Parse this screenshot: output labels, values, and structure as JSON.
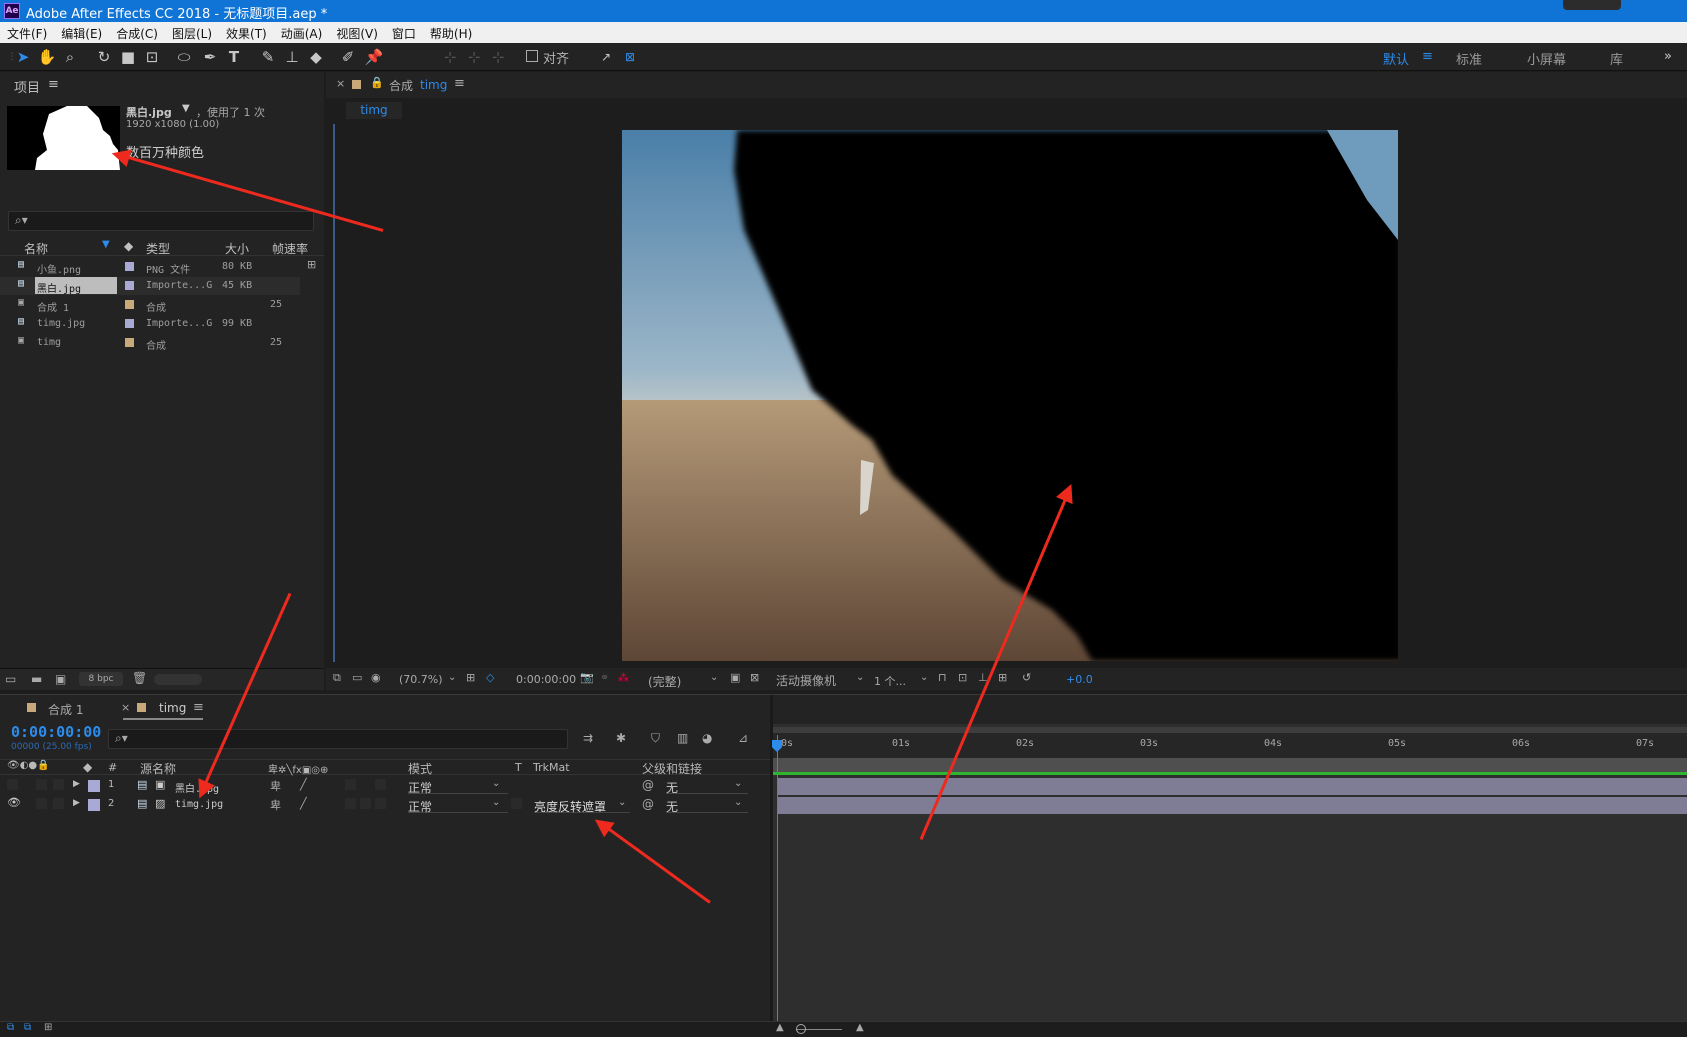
{
  "titlebar": {
    "app_icon": "Ae",
    "title": "Adobe After Effects CC 2018 - 无标题项目.aep *"
  },
  "menu": [
    "文件(F)",
    "编辑(E)",
    "合成(C)",
    "图层(L)",
    "效果(T)",
    "动画(A)",
    "视图(V)",
    "窗口",
    "帮助(H)"
  ],
  "toolbar": {
    "snap_label": "对齐",
    "workspaces": [
      "默认",
      "标准",
      "小屏幕",
      "库"
    ],
    "active_workspace": "默认",
    "more": "»"
  },
  "project": {
    "title": "项目",
    "menu_icon": "≡",
    "selected_name": "黑白.jpg",
    "usage": "，使用了 1 次",
    "dimensions": "1920 x1080 (1.00)",
    "colors": "数百万种颜色",
    "columns": [
      "名称",
      "类型",
      "大小",
      "帧速率"
    ],
    "items": [
      {
        "name": "小鱼.png",
        "type": "PNG 文件",
        "size": "80 KB",
        "fps": "",
        "swatch": "#a9a9d6",
        "icon": "image-file-icon"
      },
      {
        "name": "黑白.jpg",
        "type": "Importe...G",
        "size": "45 KB",
        "fps": "",
        "swatch": "#a9a9d6",
        "icon": "image-file-icon",
        "selected": true
      },
      {
        "name": "合成 1",
        "type": "合成",
        "size": "",
        "fps": "25",
        "swatch": "#c9a97a",
        "icon": "composition-icon"
      },
      {
        "name": "timg.jpg",
        "type": "Importe...G",
        "size": "99 KB",
        "fps": "",
        "swatch": "#a9a9d6",
        "icon": "image-file-icon"
      },
      {
        "name": "timg",
        "type": "合成",
        "size": "",
        "fps": "25",
        "swatch": "#c9a97a",
        "icon": "composition-icon"
      }
    ],
    "bpc": "8 bpc"
  },
  "composition": {
    "tab_prefix": "合成",
    "tab_name": "timg",
    "menu_icon": "≡",
    "subtab": "timg",
    "zoom": "(70.7%)",
    "timecode": "0:00:00:00",
    "resolution": "(完整)",
    "camera": "活动摄像机",
    "views": "1 个...",
    "exposure": "+0.0"
  },
  "timeline": {
    "tabs": [
      "合成 1",
      "timg"
    ],
    "active_tab": "timg",
    "menu_icon": "≡",
    "timecode": "0:00:00:00",
    "frame_info": "00000 (25.00 fps)",
    "columns": {
      "num": "#",
      "source": "源名称",
      "mode": "模式",
      "t": "T",
      "trkmat": "TrkMat",
      "parent": "父级和链接"
    },
    "layers": [
      {
        "num": "1",
        "name": "黑白.jpg",
        "mode": "正常",
        "trkmat": "",
        "parent": "无",
        "visible": false,
        "color": "#a9a9d6"
      },
      {
        "num": "2",
        "name": "timg.jpg",
        "mode": "正常",
        "trkmat": "亮度反转遮罩",
        "parent": "无",
        "visible": true,
        "color": "#a9a9d6"
      }
    ],
    "ruler": [
      "0s",
      "01s",
      "02s",
      "03s",
      "04s",
      "05s",
      "06s",
      "07s"
    ]
  },
  "colors": {
    "accent": "#2d8ceb",
    "titlebar": "#0f74d6",
    "annotation": "#ee2a1f",
    "work_area": "#2fb52f",
    "layer_bar": "#7f7d95"
  }
}
